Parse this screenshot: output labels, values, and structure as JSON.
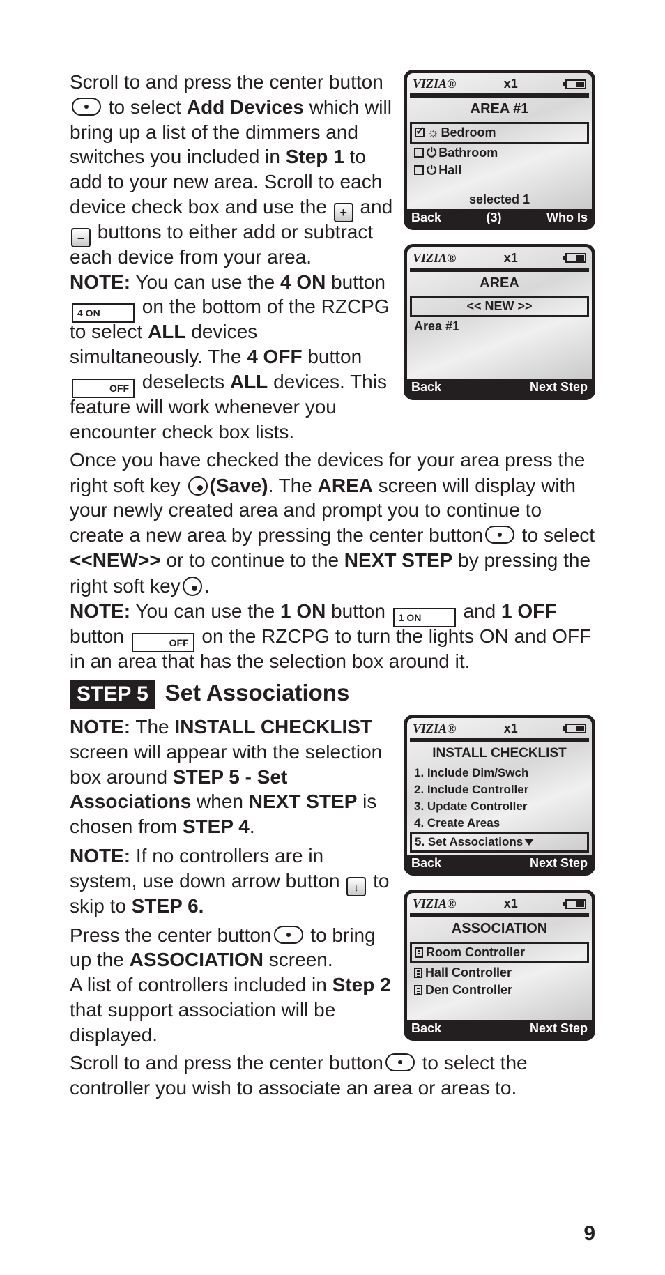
{
  "para1": {
    "t1": "Scroll to and press the center button",
    "t2": "to select ",
    "b1": "Add Devices",
    "t3": " which will bring up a list of the dimmers and switches you included in ",
    "b2": "Step 1",
    "t4": " to add to your new area. Scroll to each device check box and use the ",
    "plus": "+",
    "t5": "and ",
    "minus": "–",
    "t6": " buttons to either add or subtract each device from your area.",
    "noteLabel": "NOTE:",
    "note1": " You can use the ",
    "b3": "4 ON",
    "note2": " button ",
    "btn4on": "4 ON",
    "note3": " on the bottom of the RZCPG to select ",
    "b4": "ALL",
    "note4": " devices simultaneously. The ",
    "b5": "4 OFF",
    "note5": " button ",
    "btnoff": "OFF",
    "note6": " deselects ",
    "b6": "ALL",
    "note7": " devices. This feature will work whenever you encounter check box lists."
  },
  "screenA": {
    "brand": "VIZIA®",
    "x1": "x1",
    "title": "AREA #1",
    "row1": "Bedroom",
    "row2": "Bathroom",
    "row3": "Hall",
    "status": "selected 1",
    "back": "Back",
    "mid": "(3)",
    "right": "Who Is"
  },
  "screenB": {
    "brand": "VIZIA®",
    "x1": "x1",
    "title": "AREA",
    "new": "<< NEW >>",
    "row1": "Area #1",
    "back": "Back",
    "right": "Next Step"
  },
  "para2": {
    "t1": "Once you have checked the devices for your area press the right soft key ",
    "save": "(Save)",
    "t2": ". The ",
    "b1": "AREA",
    "t3": " screen will display with your newly created area and prompt you to continue to create a new area by pressing the center button",
    "t4": " to select ",
    "b2": "<<NEW>>",
    "t5": " or to continue to the ",
    "b3": "NEXT STEP",
    "t6": " by pressing the right soft key",
    "period": ".",
    "noteLabel": "NOTE:",
    "n1": " You can use the ",
    "b4": "1 ON",
    "n2": " button ",
    "btn1on": "1 ON",
    "n3": " and ",
    "b5": "1 OFF",
    "n4": " button ",
    "btn1off": "OFF",
    "n5": " on the RZCPG to turn the lights ON and OFF in an area that has the selection box around it."
  },
  "step5": {
    "badge": "STEP 5",
    "title": "Set Associations"
  },
  "para3": {
    "noteLabel": "NOTE:",
    "t1": " The ",
    "b1": "INSTALL CHECKLIST",
    "t2": " screen will appear with the selection box around ",
    "b2": "STEP 5 - Set Associations",
    "t3": " when ",
    "b3": "NEXT STEP",
    "t4": " is chosen from ",
    "b4": "STEP 4",
    "t5": ".",
    "note2Label": "NOTE:",
    "n1": " If no controllers are in system, use down arrow button ",
    "n2": " to skip to ",
    "b5": "STEP 6."
  },
  "screenC": {
    "brand": "VIZIA®",
    "x1": "x1",
    "title": "INSTALL CHECKLIST",
    "r1": "1. Include Dim/Swch",
    "r2": "2. Include Controller",
    "r3": "3. Update Controller",
    "r4": "4. Create Areas",
    "r5": "5. Set Associations",
    "back": "Back",
    "right": "Next Step"
  },
  "screenD": {
    "brand": "VIZIA®",
    "x1": "x1",
    "title": "ASSOCIATION",
    "r1": "Room Controller",
    "r2": "Hall Controller",
    "r3": "Den Controller",
    "back": "Back",
    "right": "Next Step"
  },
  "para4": {
    "t1": "Press the center button",
    "t2": " to bring up the ",
    "b1": "ASSOCIATION",
    "t3": " screen.",
    "t4": "A list of controllers included in ",
    "b2": "Step 2",
    "t5": " that support association will be displayed.",
    "t6": "Scroll to and press the center button",
    "t7": " to select the controller you wish to associate an area or areas to."
  },
  "pageNum": "9"
}
